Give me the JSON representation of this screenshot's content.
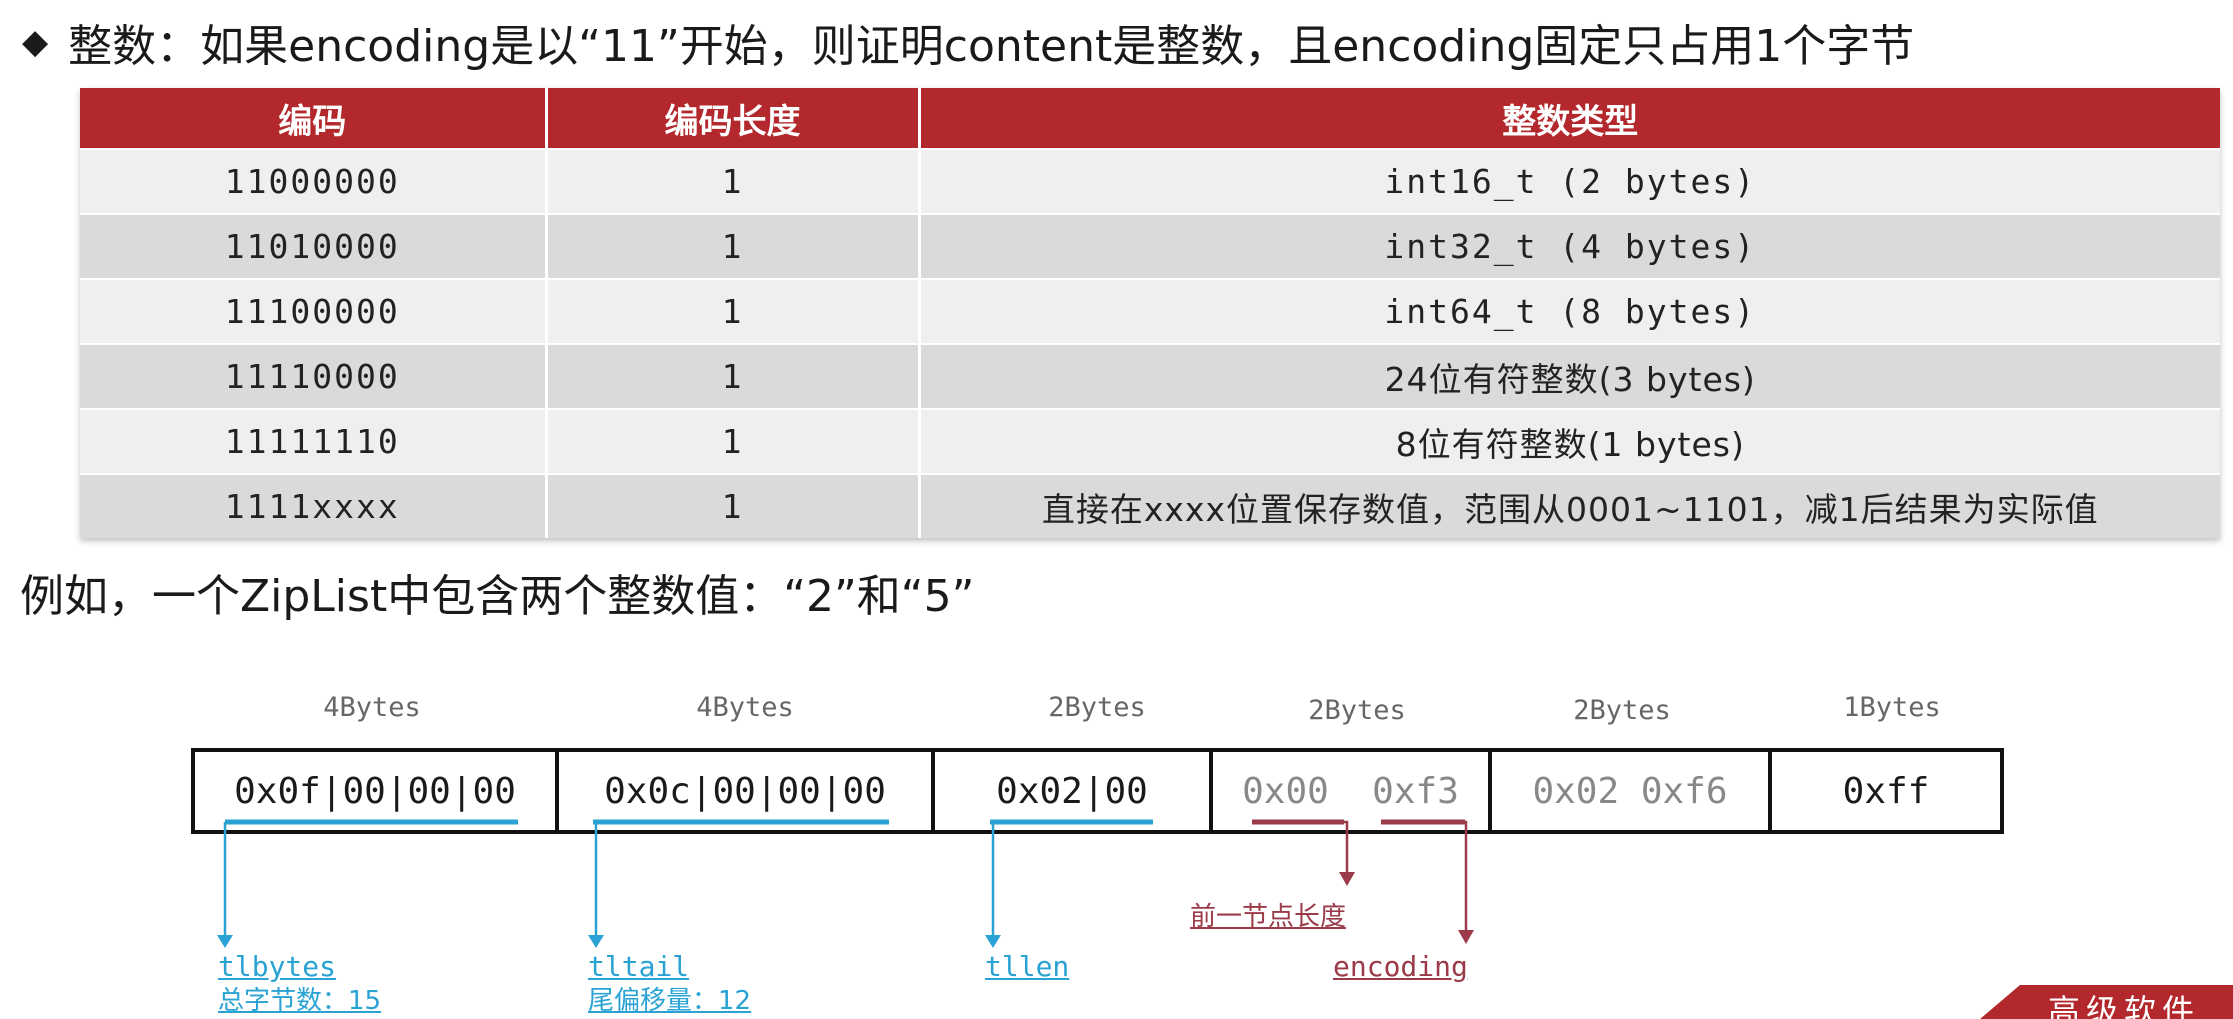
{
  "heading": {
    "bullet": "◆",
    "text": "整数：如果encoding是以“11”开始，则证明content是整数，且encoding固定只占用1个字节"
  },
  "table": {
    "headers": [
      "编码",
      "编码长度",
      "整数类型"
    ],
    "rows": [
      [
        "11000000",
        "1",
        "int16_t (2 bytes)"
      ],
      [
        "11010000",
        "1",
        "int32_t (4 bytes)"
      ],
      [
        "11100000",
        "1",
        "int64_t (8 bytes)"
      ],
      [
        "11110000",
        "1",
        "24位有符整数(3 bytes)"
      ],
      [
        "11111110",
        "1",
        "8位有符整数(1 bytes)"
      ],
      [
        "1111xxxx",
        "1",
        "直接在xxxx位置保存数值，范围从0001~1101，减1后结果为实际值"
      ]
    ]
  },
  "example_text": "例如，一个ZipList中包含两个整数值：“2”和“5”",
  "segments": [
    {
      "size": "4Bytes",
      "content": "0x0f|00|00|00"
    },
    {
      "size": "4Bytes",
      "content": "0x0c|00|00|00"
    },
    {
      "size": "2Bytes",
      "content": "0x02|00"
    },
    {
      "size": "2Bytes",
      "content": "0x00  0xf3"
    },
    {
      "size": "2Bytes",
      "content": "0x02 0xf6"
    },
    {
      "size": "1Bytes",
      "content": "0xff"
    }
  ],
  "annotations": {
    "zlbytes": {
      "name": "tlbytes",
      "desc": "总字节数：15"
    },
    "zltail": {
      "name": "tltail",
      "desc": "尾偏移量：12"
    },
    "zllen": {
      "name": "tllen"
    },
    "prevlen": {
      "name": "前一节点长度"
    },
    "encoding": {
      "name": "encoding"
    }
  },
  "logo_text": "高级软件",
  "colors": {
    "header_red": "#b3282c",
    "blue_annotation": "#2aa3d4",
    "red_annotation": "#9b3a48"
  }
}
